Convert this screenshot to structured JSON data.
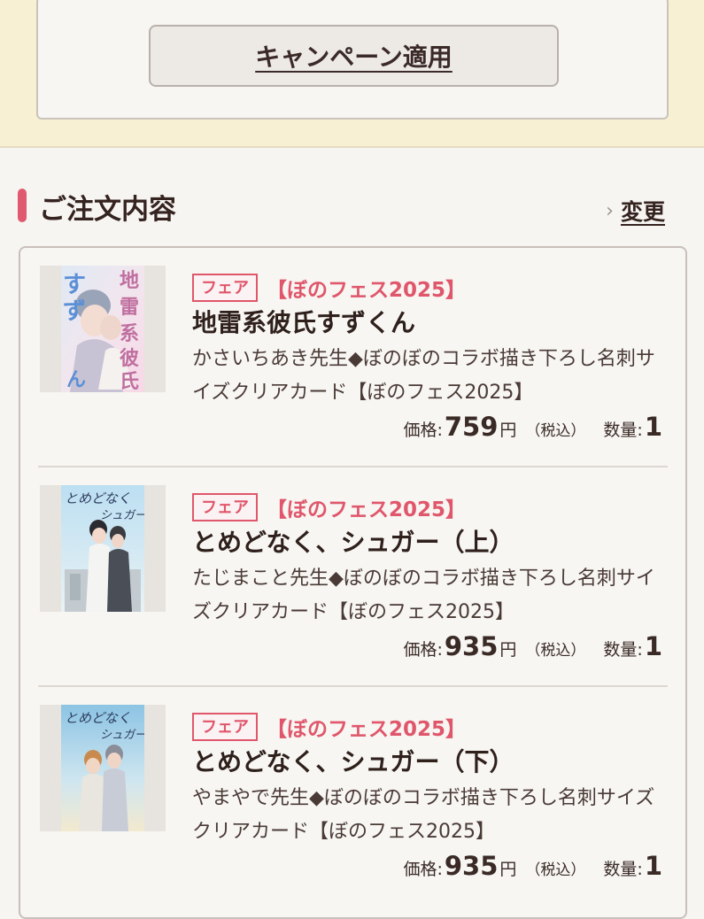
{
  "campaign": {
    "apply_label": "キャンペーン適用"
  },
  "order": {
    "section_title": "ご注文内容",
    "change_label": "変更",
    "items": [
      {
        "badge": "フェア",
        "tag": "【ぼのフェス2025】",
        "title": "地雷系彼氏すずくん",
        "description": "かさいちあき先生◆ぼのぼのコラボ描き下ろし名刺サイズクリアカード【ぼのフェス2025】",
        "price_label": "価格:",
        "price_value": "759",
        "price_unit": "円",
        "tax_note": "（税込）",
        "qty_label": "数量:",
        "qty_value": "1",
        "cover_text": "地雷系彼氏すずくん"
      },
      {
        "badge": "フェア",
        "tag": "【ぼのフェス2025】",
        "title": "とめどなく、シュガー（上）",
        "description": "たじまこと先生◆ぼのぼのコラボ描き下ろし名刺サイズクリアカード【ぼのフェス2025】",
        "price_label": "価格:",
        "price_value": "935",
        "price_unit": "円",
        "tax_note": "（税込）",
        "qty_label": "数量:",
        "qty_value": "1",
        "cover_text": "とめどなく、シュガー"
      },
      {
        "badge": "フェア",
        "tag": "【ぼのフェス2025】",
        "title": "とめどなく、シュガー（下）",
        "description": "やまやで先生◆ぼのぼのコラボ描き下ろし名刺サイズクリアカード【ぼのフェス2025】",
        "price_label": "価格:",
        "price_value": "935",
        "price_unit": "円",
        "tax_note": "（税込）",
        "qty_label": "数量:",
        "qty_value": "1",
        "cover_text": "とめどなく、シュガー"
      }
    ]
  },
  "colors": {
    "accent": "#e0566b",
    "band": "#f8f0d2",
    "text": "#3a2a26"
  }
}
